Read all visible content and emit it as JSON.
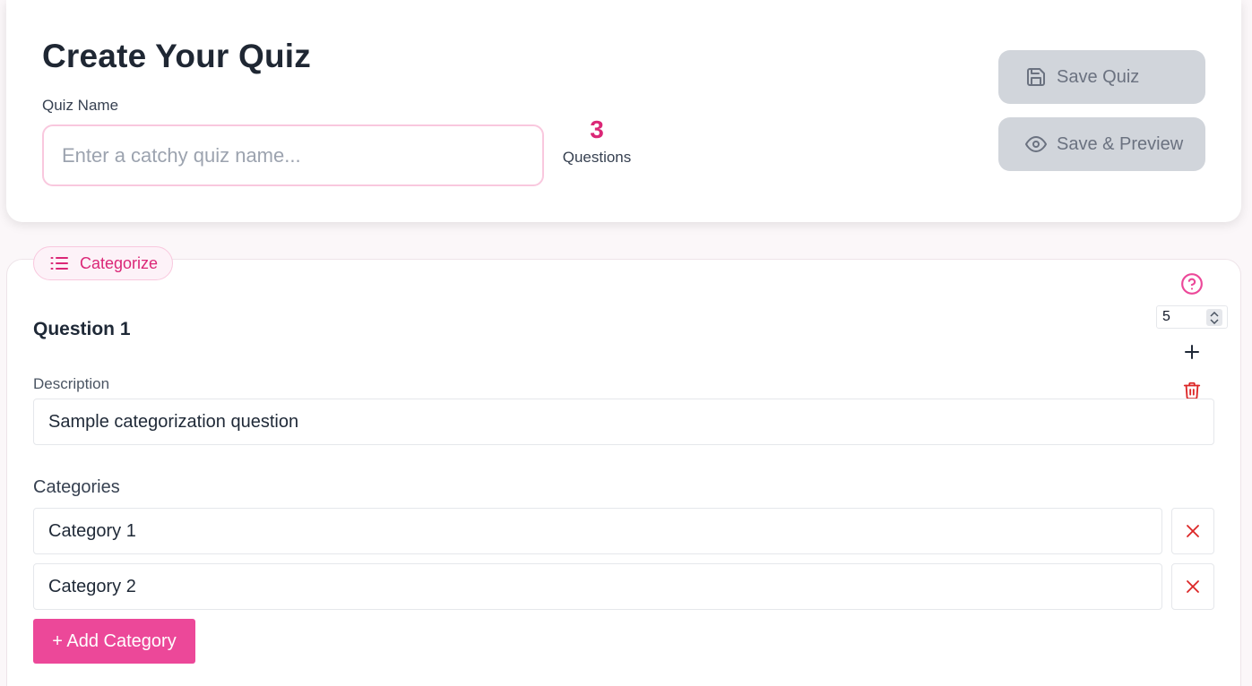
{
  "header": {
    "title": "Create Your Quiz",
    "quiz_name_label": "Quiz Name",
    "quiz_name_value": "",
    "quiz_name_placeholder": "Enter a catchy quiz name...",
    "question_count": "3",
    "question_count_label": "Questions",
    "save_label": "Save Quiz",
    "save_preview_label": "Save & Preview"
  },
  "question": {
    "type_label": "Categorize",
    "title": "Question 1",
    "description_label": "Description",
    "description_value": "Sample categorization question",
    "points": "5",
    "categories_label": "Categories",
    "categories": [
      "Category 1",
      "Category 2"
    ],
    "add_category_label": "+ Add Category"
  },
  "colors": {
    "accent": "#ec4899",
    "accent_text": "#db2777",
    "danger": "#dc2626",
    "disabled_button": "#d1d5db"
  },
  "icons": {
    "save": "save-icon",
    "preview": "eye-icon",
    "type": "list-icon",
    "help": "help-circle-icon",
    "add": "plus-icon",
    "delete": "trash-icon",
    "remove": "close-icon"
  }
}
